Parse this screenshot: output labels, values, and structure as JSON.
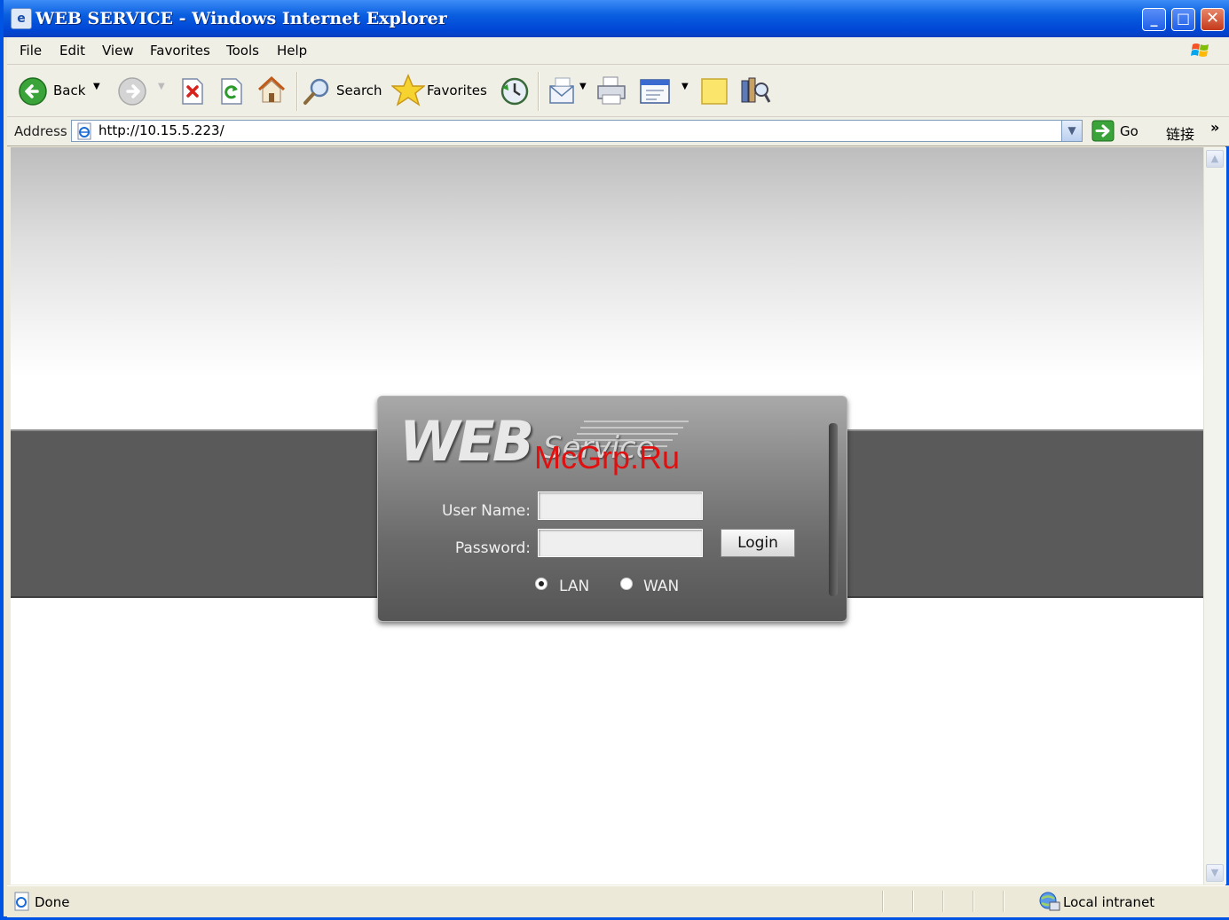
{
  "window": {
    "title": "WEB SERVICE - Windows Internet Explorer",
    "minimize_glyph": "_",
    "maximize_glyph": "□",
    "close_glyph": "✕"
  },
  "menu": [
    "File",
    "Edit",
    "View",
    "Favorites",
    "Tools",
    "Help"
  ],
  "toolbar": {
    "back_label": "Back",
    "search_label": "Search",
    "favorites_label": "Favorites"
  },
  "address": {
    "label": "Address",
    "url": "http://10.15.5.223/",
    "go_label": "Go",
    "links_label": "链接",
    "more_glyph": "»"
  },
  "login": {
    "logo_web": "WEB",
    "logo_service": "Service",
    "watermark": "McGrp.Ru",
    "username_label": "User Name:",
    "username_value": "",
    "password_label": "Password:",
    "password_value": "",
    "login_button": "Login",
    "options": [
      {
        "label": "LAN",
        "selected": true
      },
      {
        "label": "WAN",
        "selected": false
      }
    ]
  },
  "status": {
    "text": "Done",
    "zone": "Local intranet"
  },
  "colors": {
    "titlebar": "#0a5fe0",
    "band": "#5a5a5a",
    "panel": "#7a7a7a",
    "watermark": "#e01010"
  }
}
